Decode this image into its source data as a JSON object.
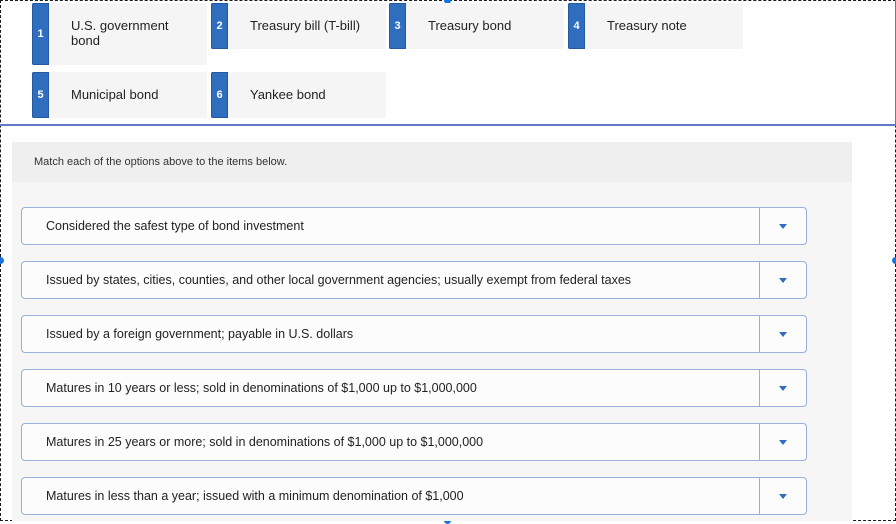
{
  "options": [
    {
      "number": "1",
      "label": "U.S. government bond"
    },
    {
      "number": "2",
      "label": "Treasury bill (T-bill)"
    },
    {
      "number": "3",
      "label": "Treasury bond"
    },
    {
      "number": "4",
      "label": "Treasury note"
    },
    {
      "number": "5",
      "label": "Municipal bond"
    },
    {
      "number": "6",
      "label": "Yankee bond"
    }
  ],
  "instructions": "Match each of the options above to the items below.",
  "items": [
    {
      "text": "Considered the safest type of bond investment",
      "selected": ""
    },
    {
      "text": "Issued by states, cities, counties, and other local government agencies; usually exempt from federal taxes",
      "selected": ""
    },
    {
      "text": "Issued by a foreign government; payable in U.S. dollars",
      "selected": ""
    },
    {
      "text": "Matures in 10 years or less; sold in denominations of $1,000 up to $1,000,000",
      "selected": ""
    },
    {
      "text": "Matures in 25 years or more; sold in denominations of $1,000 up to $1,000,000",
      "selected": ""
    },
    {
      "text": "Matures in less than a year; issued with a minimum denomination of $1,000",
      "selected": ""
    }
  ],
  "colors": {
    "accent": "#2f6dbf",
    "selection_handle": "#1a73d9",
    "row_border": "#9ab0d8"
  },
  "icons": {
    "dropdown": "chevron-down-icon"
  }
}
